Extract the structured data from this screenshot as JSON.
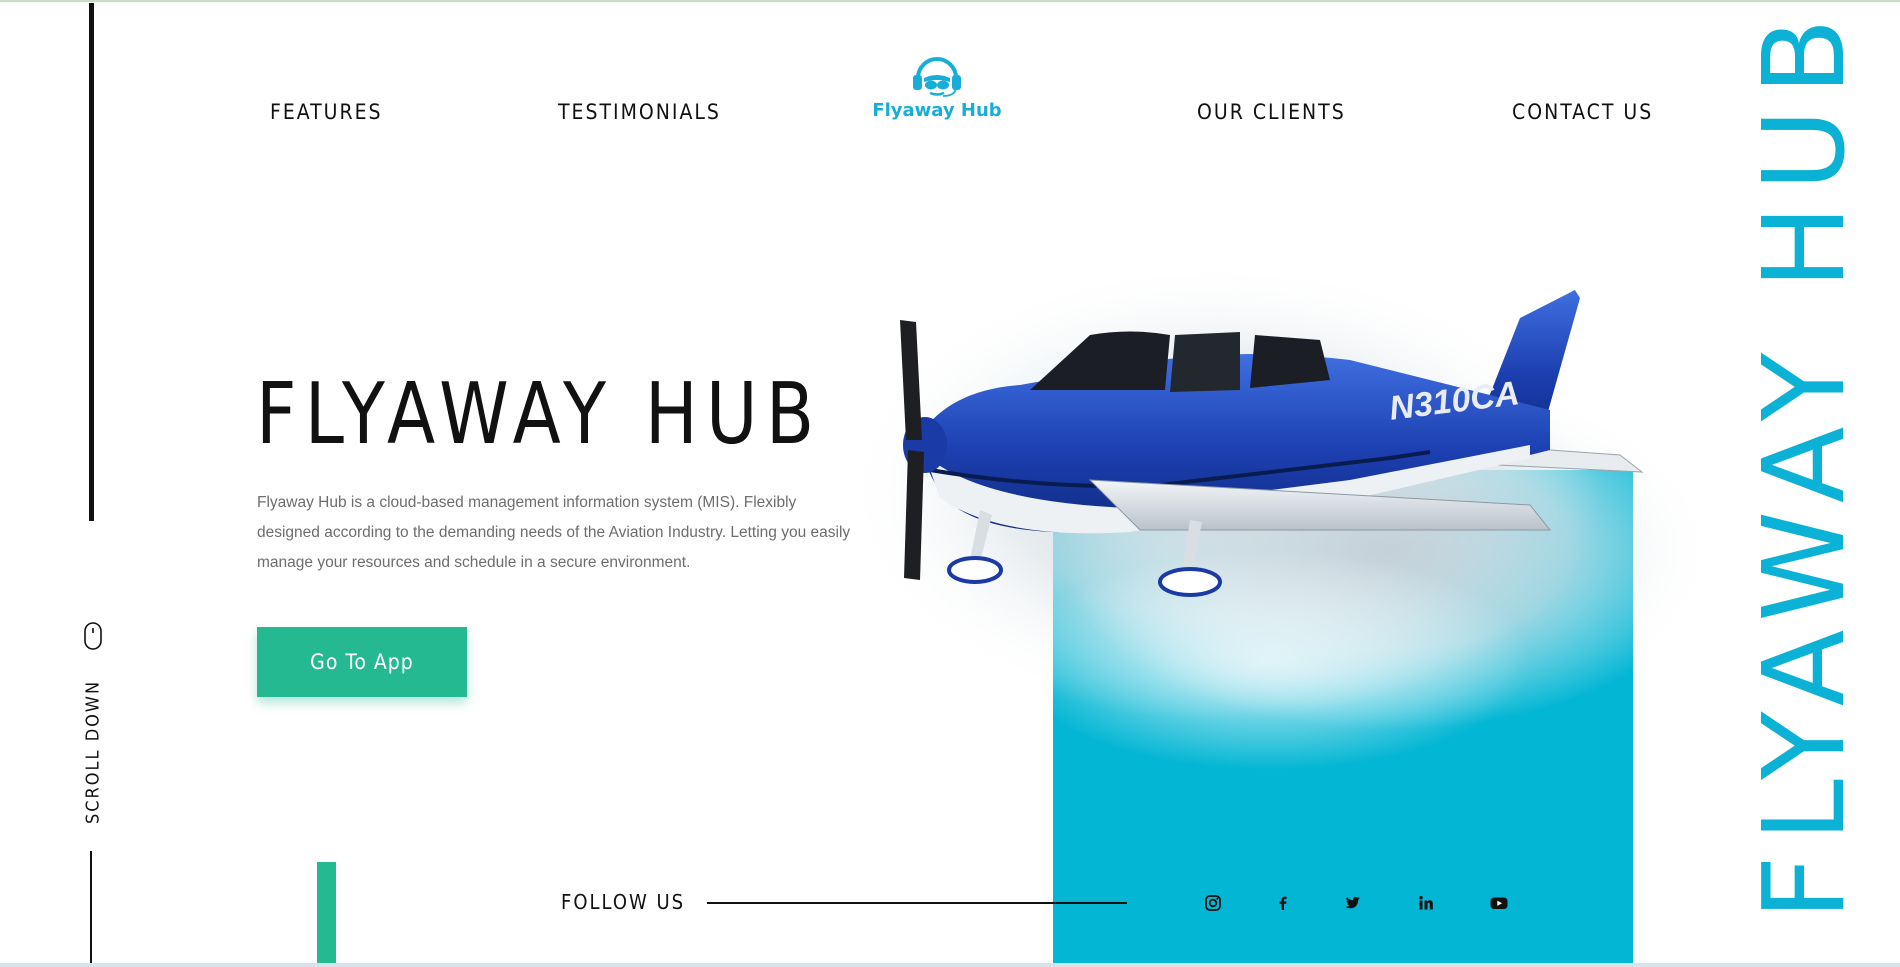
{
  "nav": {
    "features": "FEATURES",
    "testimonials": "TESTIMONIALS",
    "our_clients": "OUR CLIENTS",
    "contact_us": "CONTACT US"
  },
  "logo": {
    "text": "Flyaway Hub",
    "icon": "pilot-headset-icon"
  },
  "hero": {
    "title": "FLYAWAY HUB",
    "description": "Flyaway Hub is a cloud-based management information system (MIS). Flexibly designed according to the demanding needs of the Aviation Industry. Letting you easily manage your resources and schedule in a secure environment.",
    "cta_label": "Go To App",
    "plane_registration": "N310CA"
  },
  "side": {
    "scroll_label": "SCROLL DOWN",
    "vertical_brand": "FLYAWAY HUB"
  },
  "footer": {
    "follow_label": "FOLLOW US",
    "socials": [
      "instagram-icon",
      "facebook-icon",
      "twitter-icon",
      "linkedin-icon",
      "youtube-icon"
    ]
  },
  "colors": {
    "accent_teal": "#25b991",
    "brand_cyan": "#03b6d4",
    "text_dark": "#111111",
    "text_muted": "#6d6d6d"
  }
}
